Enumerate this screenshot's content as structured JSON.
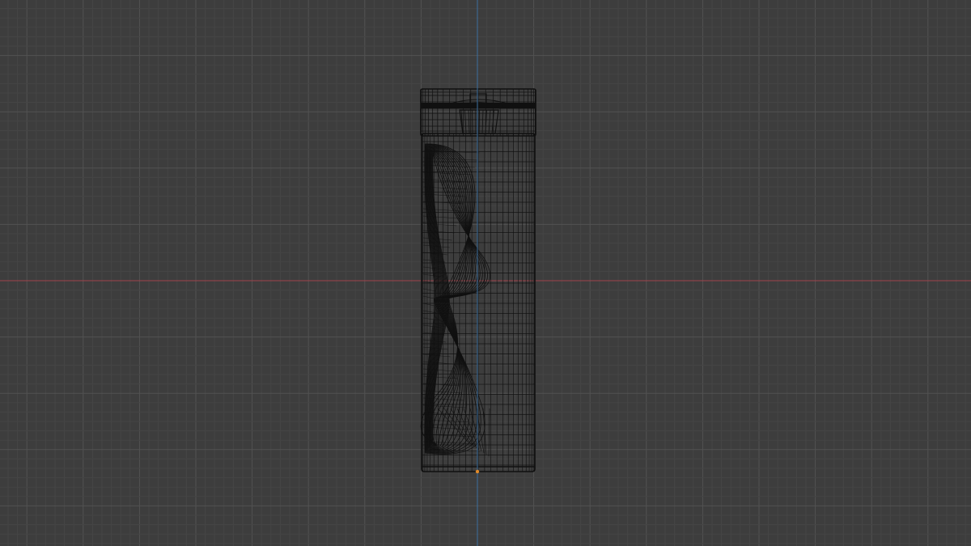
{
  "viewport": {
    "view": "front-orthographic",
    "shading": "wireframe",
    "colors": {
      "background": "#3d3d3d",
      "grid_minor": "#454545",
      "grid_major": "#525252",
      "axis_x": "#a0434b",
      "axis_z": "#3b6fa0",
      "wire": "#101010",
      "origin": "#e08a2a"
    }
  },
  "object": {
    "kind": "cylindrical-container-mesh",
    "display": "wireframe",
    "has_cap": true,
    "has_grip_recess": true
  }
}
